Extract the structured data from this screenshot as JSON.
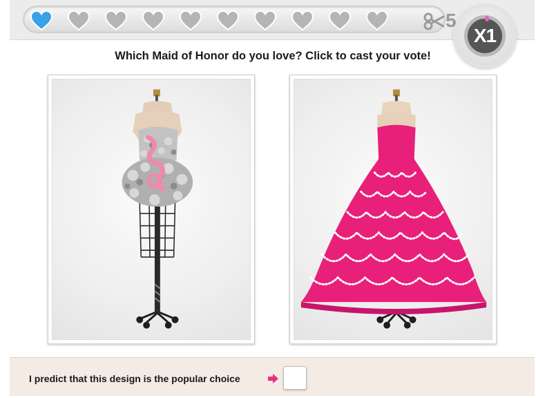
{
  "hearts": {
    "total": 10,
    "filled": 1,
    "filled_color": "#3aa0e8",
    "empty_color": "#b5b5b5",
    "icon": "heart-icon"
  },
  "scissors": {
    "icon": "scissors-icon",
    "count": "5"
  },
  "multiplier": {
    "label": "X1"
  },
  "question": "Which Maid of Honor do you love? Click to cast your vote!",
  "designs": [
    {
      "name": "sequin-mini-dress",
      "colors": [
        "#b8b8b8",
        "#f08aa8"
      ]
    },
    {
      "name": "pink-pearl-ball-gown",
      "colors": [
        "#e8207a",
        "#ffffff"
      ]
    }
  ],
  "prediction": {
    "label": "I predict that this design is the popular choice",
    "arrow_color": "#e8307e"
  }
}
